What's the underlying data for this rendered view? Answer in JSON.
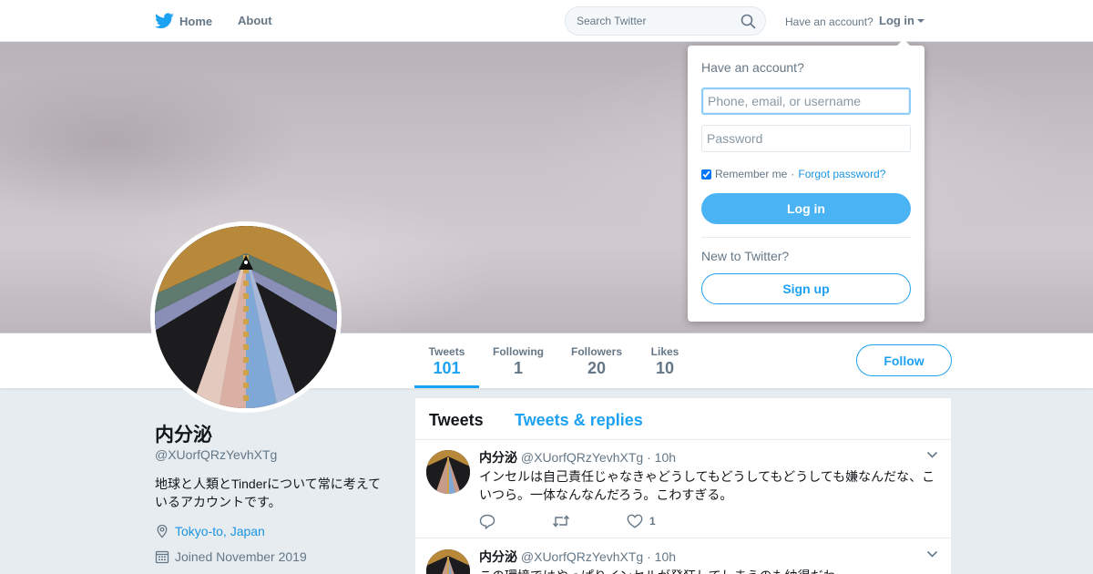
{
  "nav": {
    "home_label": "Home",
    "about_label": "About",
    "search_placeholder": "Search Twitter",
    "have_account": "Have an account?",
    "login_label": "Log in"
  },
  "login_dropdown": {
    "title": "Have an account?",
    "username_placeholder": "Phone, email, or username",
    "password_placeholder": "Password",
    "remember_label": "Remember me",
    "separator": "·",
    "forgot_label": "Forgot password?",
    "login_button": "Log in",
    "new_label": "New to Twitter?",
    "signup_button": "Sign up"
  },
  "profile": {
    "name": "内分泌",
    "handle": "@XUorfQRzYevhXTg",
    "bio": "地球と人類とTinderについて常に考えているアカウントです。",
    "location": "Tokyo-to, Japan",
    "joined": "Joined November 2019"
  },
  "stats": [
    {
      "label": "Tweets",
      "value": "101",
      "active": true
    },
    {
      "label": "Following",
      "value": "1",
      "active": false
    },
    {
      "label": "Followers",
      "value": "20",
      "active": false
    },
    {
      "label": "Likes",
      "value": "10",
      "active": false
    }
  ],
  "follow_button": "Follow",
  "timeline": {
    "tabs": [
      "Tweets",
      "Tweets & replies"
    ],
    "tweets": [
      {
        "name": "内分泌",
        "handle": "@XUorfQRzYevhXTg",
        "dot": "·",
        "time": "10h",
        "text": "インセルは自己責任じゃなきゃどうしてもどうしてもどうしても嫌なんだな、こいつら。一体なんなんだろう。こわすぎる。",
        "like_count": "1"
      },
      {
        "name": "内分泌",
        "handle": "@XUorfQRzYevhXTg",
        "dot": "·",
        "time": "10h",
        "text": "この環境ではやっぱりインセルが発狂してしまうのも納得だわ"
      }
    ]
  },
  "colors": {
    "accent": "#1da1f2",
    "login_button": "#4ab3f4",
    "link": "#1b95e0",
    "muted": "#657786",
    "background": "#e6ecf0"
  },
  "icons": [
    "twitter-bird-icon",
    "home-icon",
    "search-icon",
    "location-pin-icon",
    "calendar-icon",
    "reply-icon",
    "retweet-icon",
    "like-icon",
    "chevron-down-icon"
  ]
}
